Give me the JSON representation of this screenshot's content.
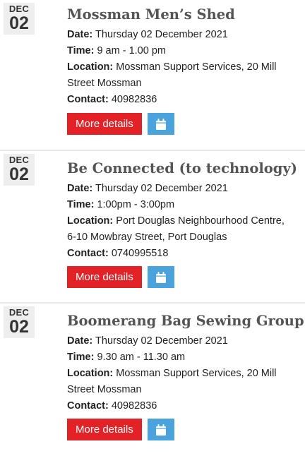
{
  "events": [
    {
      "month": "DEC",
      "day": "02",
      "title": "Mossman Men’s Shed",
      "date_label": "Date:",
      "date": "Thursday 02 December 2021",
      "time_label": "Time:",
      "time": "9 am - 1.00 pm",
      "location_label": "Location:",
      "location_line1": "Mossman Support Services, 20 Mill",
      "location_line2": "Street Mossman",
      "contact_label": "Contact:",
      "contact": "40982836",
      "more_label": "More details"
    },
    {
      "month": "DEC",
      "day": "02",
      "title": "Be Connected (to technology)",
      "date_label": "Date:",
      "date": "Thursday 02 December 2021",
      "time_label": "Time:",
      "time": "1:00pm - 3:00pm",
      "location_label": "Location:",
      "location_line1": "Port Douglas Neighbourhood Centre,",
      "location_line2": "6-10 Mowbray Street, Port Douglas",
      "contact_label": "Contact:",
      "contact": "0740995518",
      "more_label": "More details"
    },
    {
      "month": "DEC",
      "day": "02",
      "title": "Boomerang Bag Sewing Group",
      "date_label": "Date:",
      "date": "Thursday 02 December 2021",
      "time_label": "Time:",
      "time": "9.30 am - 11.30 am",
      "location_label": "Location:",
      "location_line1": "Mossman Support Services, 20 Mill",
      "location_line2": "Street Mossman",
      "contact_label": "Contact:",
      "contact": "40982836",
      "more_label": "More details"
    }
  ],
  "colors": {
    "more_button": "#e32227",
    "calendar_button": "#4aa3dc",
    "date_badge_bg": "#eeeeee",
    "title_text": "#555555"
  },
  "icons": {
    "calendar_button": "calendar-icon"
  }
}
